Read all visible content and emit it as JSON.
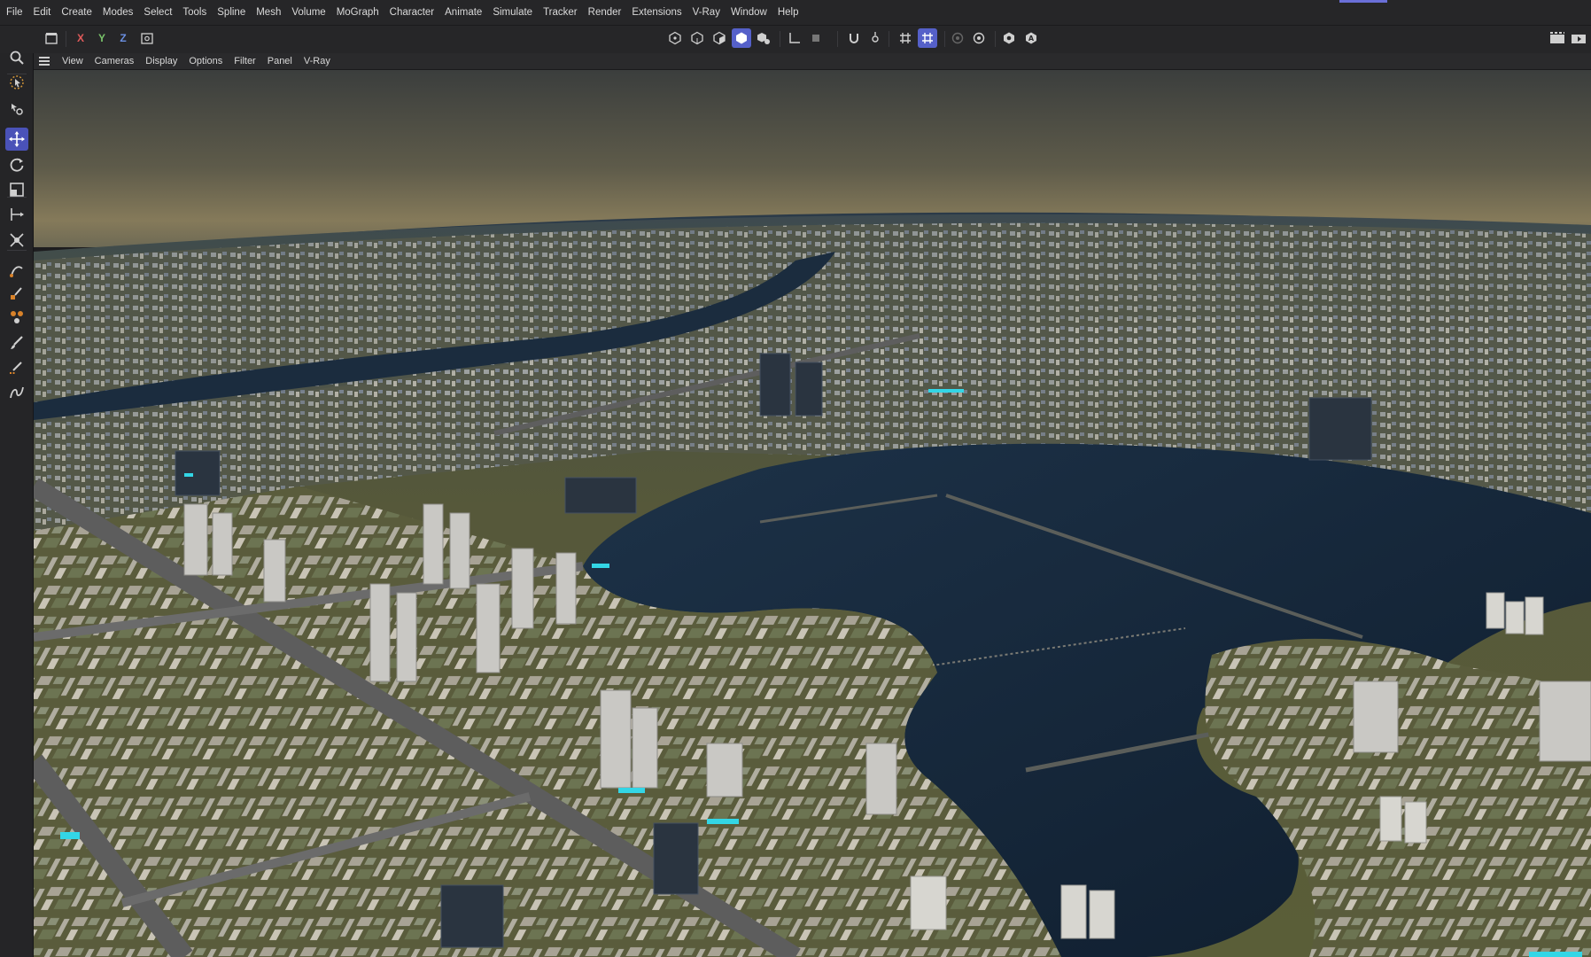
{
  "menubar": {
    "items": [
      "File",
      "Edit",
      "Create",
      "Modes",
      "Select",
      "Tools",
      "Spline",
      "Mesh",
      "Volume",
      "MoGraph",
      "Character",
      "Animate",
      "Simulate",
      "Tracker",
      "Render",
      "Extensions",
      "V-Ray",
      "Window",
      "Help"
    ]
  },
  "toolbar": {
    "axis_x": "X",
    "axis_y": "Y",
    "axis_z": "Z"
  },
  "viewport_menu": {
    "items": [
      "View",
      "Cameras",
      "Display",
      "Options",
      "Filter",
      "Panel",
      "V-Ray"
    ]
  },
  "colors": {
    "accent": "#5560c9",
    "panel": "#262628",
    "water": "#16263a",
    "sky_top": "#3a3d3c",
    "sky_horizon": "#857a5a"
  },
  "icons": {
    "left_tools": [
      "search-icon",
      "select-icon",
      "move-axis-icon",
      "move-icon",
      "rotate-icon",
      "scale-icon",
      "transform-icon",
      "snap-icon",
      "pen-icon",
      "paint-icon",
      "brush-icon",
      "knife-icon",
      "spline-icon"
    ]
  }
}
